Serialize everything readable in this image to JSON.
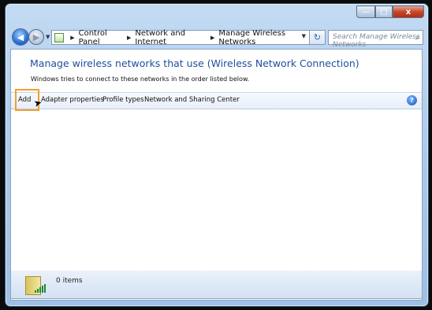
{
  "window": {
    "caption_buttons": {
      "minimize": "—",
      "maximize": "□",
      "close": "x"
    }
  },
  "nav": {
    "back_icon": "◀",
    "forward_icon": "▶",
    "history_icon": "▼",
    "breadcrumb": [
      "Control Panel",
      "Network and Internet",
      "Manage Wireless Networks"
    ],
    "separator": "▶",
    "address_dropdown": "▼",
    "refresh_icon": "↻",
    "search_placeholder": "Search Manage Wireless Networks",
    "search_icon": "⌕"
  },
  "content": {
    "heading": "Manage wireless networks that use (Wireless Network Connection)",
    "subtext": "Windows tries to connect to these networks in the order listed below."
  },
  "toolbar": {
    "items": [
      "Add",
      "Adapter properties",
      "Profile types",
      "Network and Sharing Center"
    ],
    "help_icon": "?"
  },
  "status": {
    "count": "0 items"
  },
  "colors": {
    "accent": "#1e4f9d",
    "highlight": "#f0a030"
  }
}
